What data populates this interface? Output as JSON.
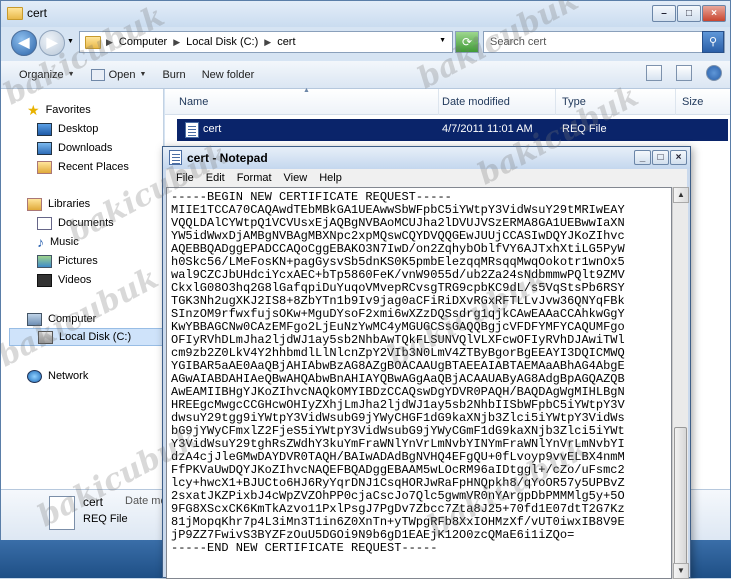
{
  "explorer": {
    "title": "cert",
    "address": {
      "segments": [
        "Computer",
        "Local Disk (C:)",
        "cert"
      ]
    },
    "search_placeholder": "Search cert",
    "toolbar": {
      "organize": "Organize",
      "open": "Open",
      "burn": "Burn",
      "new_folder": "New folder"
    },
    "nav": {
      "favorites": "Favorites",
      "desktop": "Desktop",
      "downloads": "Downloads",
      "recent": "Recent Places",
      "libraries": "Libraries",
      "documents": "Documents",
      "music": "Music",
      "pictures": "Pictures",
      "videos": "Videos",
      "computer": "Computer",
      "local_disk": "Local Disk (C:)",
      "network": "Network"
    },
    "columns": {
      "name": "Name",
      "date": "Date modified",
      "type": "Type",
      "size": "Size"
    },
    "file": {
      "name": "cert",
      "date": "4/7/2011 11:01 AM",
      "type": "REQ File"
    },
    "details": {
      "name": "cert",
      "date_label": "Date mo",
      "type": "REQ File"
    }
  },
  "notepad": {
    "title": "cert - Notepad",
    "menu": {
      "file": "File",
      "edit": "Edit",
      "format": "Format",
      "view": "View",
      "help": "Help"
    },
    "lines": [
      "-----BEGIN NEW CERTIFICATE REQUEST-----",
      "MIIE1TCCA70CAQAwdTEbMBkGA1UEAwwSbWFpbC5iYWtpY3VidWsuY29tMRIwEAY",
      "VQQLDAlCYWtpQ1VCVUsxEjAQBgNVBAoMCUJha2lDVUJVSzERMA8GA1UEBwwIaXN",
      "YW5idWwxDjAMBgNVBAgMBXNpc2xpMQswCQYDVQQGEwJUUjCCASIwDQYJKoZIhvc",
      "AQEBBQADggEPADCCAQoCggEBAKO3N7IwD/on2ZqhybOblfVY6AJTxhXtiLG5PyW",
      "h0Skc56/LMeFosKN+pagGysvSb5dnKS0K5pmbElezqqMRsqqMwqOokotr1wnOx5",
      "wal9CZCJbUHdciYcxAEC+bTp5860FeK/vnW9055d/ub2Za24sNdbmmwPQlt9ZMV",
      "CkxlG08O3hq2G8lGafqpiDuYuqoVMvepRCvsgTRG9cpbKC9dL/s5VqStsPb6RSY",
      "TGK3Nh2ugXKJ2IS8+8ZbYTn1b9Iv9jag0aCFiRiDXvRGxRFTLLvJvw36QNYqFBk",
      "SInzOM9rfwxfujsOKw+MguDYsoF2xmi6wXZzDQSsdrg1qjkCAwEAAaCCAhkwGgY",
      "KwYBBAGCNw0CAzEMFgo2LjEuNzYwMC4yMGUGCSsGAQQBgjcVFDFYMFYCAQUMFgo",
      "OFIyRVhDLmJha2ljdWJ1ay5sb2NhbAwTQkFLSUNVQlVLXFcwOFIyRVhDJAwiTWl",
      "cm9zb2Z0LkV4Y2hhbmdlLlNlcnZpY2VIb3N0LmV4ZTByBgorBgEEAYI3DQICMWQ",
      "YGIBAR5aAE0AaQBjAHIAbwBzAG8AZgBOACAAUgBTAEEAIABTAEMAaABhAG4AbgE",
      "AGwAIABDAHIAeQBwAHQAbwBnAHIAYQBwAGgAaQBjACAAUAByAG8AdgBpAGQAZQB",
      "AwEAMIIBHgYJKoZIhvcNAQkOMYIBDzCCAQswDgYDVR0PAQH/BAQDAgWgMIHLBgN",
      "HREEgcMwgcCCGHcwOHIyZXhjLmJha2ljdWJ1ay5sb2NhbIISbWFpbC5iYWtpY3V",
      "dwsuY29tgg9iYWtpY3VidWsubG9jYWyCHGF1dG9kaXNjb3Zlci5iYWtpY3VidWs",
      "bG9jYWyCFmxlZ2FjeS5iYWtpY3VidWsubG9jYWyCGmF1dG9kaXNjb3Zlci5iYWt",
      "Y3VidWsuY29tghRsZWdhY3kuYmFraWNlYnVrLmNvbYINYmFraWNlYnVrLmNvbYI",
      "dzA4cjJleGMwDAYDVR0TAQH/BAIwADAdBgNVHQ4EFgQU+0fLvoyp9vvELBX4nmM",
      "FfPKVaUwDQYJKoZIhvcNAQEFBQADggEBAAM5wLOcRM96aIDtggl+/cZo/uFsmc2",
      "lcy+hwcX1+BJUCto6HJ6RyYqrDNJ1CsqHORJwRaFpHNQpkh8/qYoOR57y5UPBvZ",
      "2sxatJKZPixbJ4cWpZVZOhPP0cjaCscJo7Qlc5gwmVR0nYArgpDbPMMMlg5y+5O",
      "9FG8XScxCK6KmTkAzvo11PxlPsgJ7PgDv7Zbcc7Zta8J25+70fd1E07dtT2G7Kz",
      "81jMopqKhr7p4L3iMn3T1in6Z0XnTn+yTWpgRFb8XxIOHMzXf/vUT0iwxIB8V9E",
      "jP9ZZ7FwivS3BYZFzOuU5DGOi9N9b6gD1EAEjK12O0zcQMaE6i1iZQo=",
      "-----END NEW CERTIFICATE REQUEST-----"
    ]
  },
  "watermark": "bakicubuk"
}
